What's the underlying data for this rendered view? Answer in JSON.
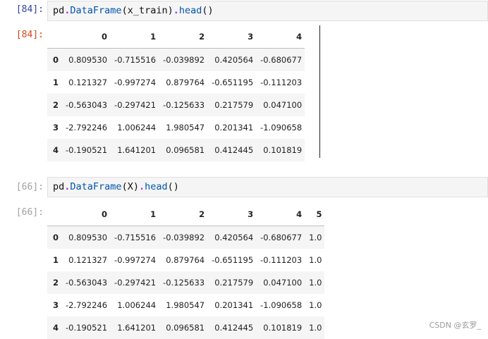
{
  "cells": [
    {
      "in_prompt": "[84]:",
      "code": {
        "obj": "pd",
        "dot1": ".",
        "cls": "DataFrame",
        "open": "(",
        "arg": "x_train",
        "close": ")",
        "dot2": ".",
        "meth": "head",
        "call": "()"
      },
      "out_prompt": "[84]:",
      "table": {
        "columns": [
          "",
          "0",
          "1",
          "2",
          "3",
          "4"
        ],
        "rows": [
          [
            "0",
            "0.809530",
            "-0.715516",
            "-0.039892",
            "0.420564",
            "-0.680677"
          ],
          [
            "1",
            "0.121327",
            "-0.997274",
            "0.879764",
            "-0.651195",
            "-0.111203"
          ],
          [
            "2",
            "-0.563043",
            "-0.297421",
            "-0.125633",
            "0.217579",
            "0.047100"
          ],
          [
            "3",
            "-2.792246",
            "1.006244",
            "1.980547",
            "0.201341",
            "-1.090658"
          ],
          [
            "4",
            "-0.190521",
            "1.641201",
            "0.096581",
            "0.412445",
            "0.101819"
          ]
        ]
      }
    },
    {
      "in_prompt": "[66]:",
      "code": {
        "obj": "pd",
        "dot1": ".",
        "cls": "DataFrame",
        "open": "(",
        "arg": "X",
        "close": ")",
        "dot2": ".",
        "meth": "head",
        "call": "()"
      },
      "out_prompt": "[66]:",
      "table": {
        "columns": [
          "",
          "0",
          "1",
          "2",
          "3",
          "4",
          "5"
        ],
        "rows": [
          [
            "0",
            "0.809530",
            "-0.715516",
            "-0.039892",
            "0.420564",
            "-0.680677",
            "1.0"
          ],
          [
            "1",
            "0.121327",
            "-0.997274",
            "0.879764",
            "-0.651195",
            "-0.111203",
            "1.0"
          ],
          [
            "2",
            "-0.563043",
            "-0.297421",
            "-0.125633",
            "0.217579",
            "0.047100",
            "1.0"
          ],
          [
            "3",
            "-2.792246",
            "1.006244",
            "1.980547",
            "0.201341",
            "-1.090658",
            "1.0"
          ],
          [
            "4",
            "-0.190521",
            "1.641201",
            "0.096581",
            "0.412445",
            "0.101819",
            "1.0"
          ]
        ]
      }
    }
  ],
  "watermark": "CSDN @玄罗_"
}
